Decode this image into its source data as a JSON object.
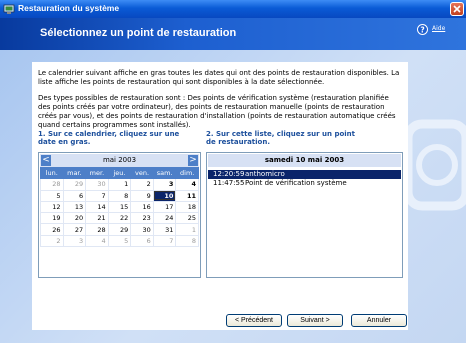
{
  "window": {
    "title": "Restauration du système",
    "icons": {
      "app": "system-restore-icon",
      "close": "close-icon"
    }
  },
  "header": {
    "title": "Sélectionnez un point de restauration",
    "help_icon": "help-icon",
    "help_label": "Aide"
  },
  "intro": {
    "p1": "Le calendrier suivant affiche en gras toutes les dates qui ont des points de restauration disponibles. La liste affiche les points de restauration qui sont disponibles à la date sélectionnée.",
    "p2": "Des types possibles de restauration sont : Des points de vérification système (restauration planifiée des points créés par votre ordinateur), des points de restauration manuelle (points de restauration créés par vous), et des points de restauration d'installation (points de restauration automatique créés quand certains programmes sont installés)."
  },
  "step1": {
    "label": "1. Sur ce calendrier, cliquez sur une date en gras."
  },
  "step2": {
    "label": "2. Sur cette liste, cliquez sur un point de restauration."
  },
  "calendar": {
    "prev_label": "<",
    "next_label": ">",
    "month_label": "mai 2003",
    "weekdays": [
      "lun.",
      "mar.",
      "mer.",
      "jeu.",
      "ven.",
      "sam.",
      "dim."
    ],
    "weeks": [
      [
        "28",
        "29",
        "30",
        "1",
        "2",
        "3",
        "4"
      ],
      [
        "5",
        "6",
        "7",
        "8",
        "9",
        "10",
        "11"
      ],
      [
        "12",
        "13",
        "14",
        "15",
        "16",
        "17",
        "18"
      ],
      [
        "19",
        "20",
        "21",
        "22",
        "23",
        "24",
        "25"
      ],
      [
        "26",
        "27",
        "28",
        "29",
        "30",
        "31",
        "1"
      ],
      [
        "2",
        "3",
        "4",
        "5",
        "6",
        "7",
        "8"
      ]
    ],
    "selected_day": "10"
  },
  "restore_list": {
    "date_label": "samedi 10 mai 2003",
    "items": [
      {
        "time": "12:20:59",
        "description": "anthomicro",
        "selected": true
      },
      {
        "time": "11:47:55",
        "description": "Point de vérification système",
        "selected": false
      }
    ]
  },
  "buttons": {
    "back": "< Précédent",
    "next": "Suivant >",
    "cancel": "Annuler"
  }
}
